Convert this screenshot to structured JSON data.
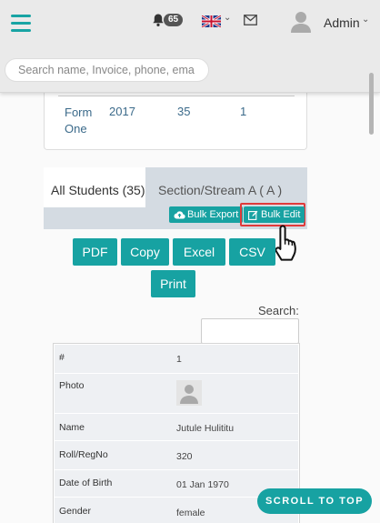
{
  "header": {
    "notification_count": "65",
    "user_name": "Admin",
    "search_placeholder": "Search name, Invoice, phone, ema"
  },
  "summary_row": {
    "form": "Form One",
    "year": "2017",
    "count": "35",
    "stream": "1"
  },
  "tabs": [
    {
      "label": "All Students (35)"
    },
    {
      "label": "Section/Stream A ( A )"
    }
  ],
  "actions": {
    "bulk_export": "Bulk Export",
    "bulk_edit": "Bulk Edit"
  },
  "export_buttons": [
    "PDF",
    "Copy",
    "Excel",
    "CSV",
    "Print"
  ],
  "table_search_label": "Search:",
  "student": {
    "rows": [
      {
        "label": "#",
        "value": "1"
      },
      {
        "label": "Photo",
        "value": ""
      },
      {
        "label": "Name",
        "value": "Jutule Hulititu"
      },
      {
        "label": "Roll/RegNo",
        "value": "320"
      },
      {
        "label": "Date of Birth",
        "value": "01 Jan 1970"
      },
      {
        "label": "Gender",
        "value": "female"
      }
    ]
  },
  "scroll_to_top": "SCROLL TO TOP",
  "colors": {
    "accent": "#17a2a2",
    "highlight": "#e03a3a"
  }
}
